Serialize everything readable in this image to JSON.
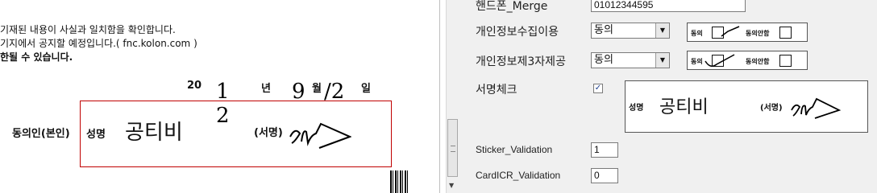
{
  "document": {
    "lines": [
      "기재된 내용이 사실과 일치함을 확인합니다.",
      "기지에서 공지할 예정입니다.( fnc.kolon.com )",
      "한될 수 있습니다."
    ],
    "date": {
      "prefix": "20",
      "year_hw": "1 2",
      "year_unit": "년",
      "month_hw": "9",
      "month_unit": "월",
      "day_hw": "/2",
      "day_unit": "일"
    },
    "consent_person_label": "동의인(본인)",
    "name_label": "성명",
    "name_handwritten": "공티비",
    "signature_label": "(서명)"
  },
  "form": {
    "phone": {
      "label": "핸드폰_Merge",
      "value": "01012344595"
    },
    "privacy_collect": {
      "label": "개인정보수집이용",
      "value": "동의",
      "agree_label": "동의",
      "disagree_label": "동의안함"
    },
    "privacy_third": {
      "label": "개인정보제3자제공",
      "value": "동의",
      "agree_label": "동의",
      "disagree_label": "동의안함"
    },
    "signature_check": {
      "label": "서명체크",
      "checked_mark": "✓",
      "name_label": "성명",
      "name_handwritten": "공티비",
      "sign_label": "(서명)"
    },
    "sticker": {
      "label": "Sticker_Validation",
      "value": "1"
    },
    "cardicr": {
      "label": "CardICR_Validation",
      "value": "0"
    },
    "dropdown_arrow": "▼",
    "scroll_down_arrow": "▼"
  }
}
